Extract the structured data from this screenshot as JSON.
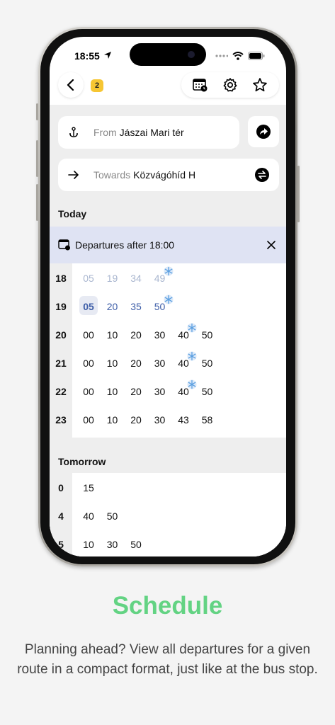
{
  "status_bar": {
    "time": "18:55"
  },
  "header": {
    "badge": "2"
  },
  "route": {
    "from_label": "From",
    "from_value": "Jászai Mari tér",
    "towards_label": "Towards",
    "towards_value": "Közvágóhíd H"
  },
  "today": {
    "title": "Today",
    "filter_text": "Departures after 18:00",
    "rows": [
      {
        "hour": "18",
        "minutes": [
          "05",
          "19",
          "34",
          "49"
        ],
        "state": "past",
        "snow": [
          3
        ]
      },
      {
        "hour": "19",
        "minutes": [
          "05",
          "20",
          "35",
          "50"
        ],
        "state": "next",
        "snow": [
          3
        ]
      },
      {
        "hour": "20",
        "minutes": [
          "00",
          "10",
          "20",
          "30",
          "40",
          "50"
        ],
        "state": "normal",
        "snow": [
          4
        ]
      },
      {
        "hour": "21",
        "minutes": [
          "00",
          "10",
          "20",
          "30",
          "40",
          "50"
        ],
        "state": "normal",
        "snow": [
          4
        ]
      },
      {
        "hour": "22",
        "minutes": [
          "00",
          "10",
          "20",
          "30",
          "40",
          "50"
        ],
        "state": "normal",
        "snow": [
          4
        ]
      },
      {
        "hour": "23",
        "minutes": [
          "00",
          "10",
          "20",
          "30",
          "43",
          "58"
        ],
        "state": "normal",
        "snow": []
      }
    ]
  },
  "tomorrow": {
    "title": "Tomorrow",
    "rows": [
      {
        "hour": "0",
        "minutes": [
          "15"
        ]
      },
      {
        "hour": "4",
        "minutes": [
          "40",
          "50"
        ]
      },
      {
        "hour": "5",
        "minutes": [
          "10",
          "30",
          "50"
        ]
      }
    ]
  },
  "marketing": {
    "headline": "Schedule",
    "description": "Planning ahead? View all departures for a given route in a compact format, just like at the bus stop."
  },
  "colors": {
    "accent_green": "#63d383",
    "filter_banner": "#dfe3f3",
    "badge_yellow": "#f6c633",
    "next_blue": "#3e5ea8"
  }
}
